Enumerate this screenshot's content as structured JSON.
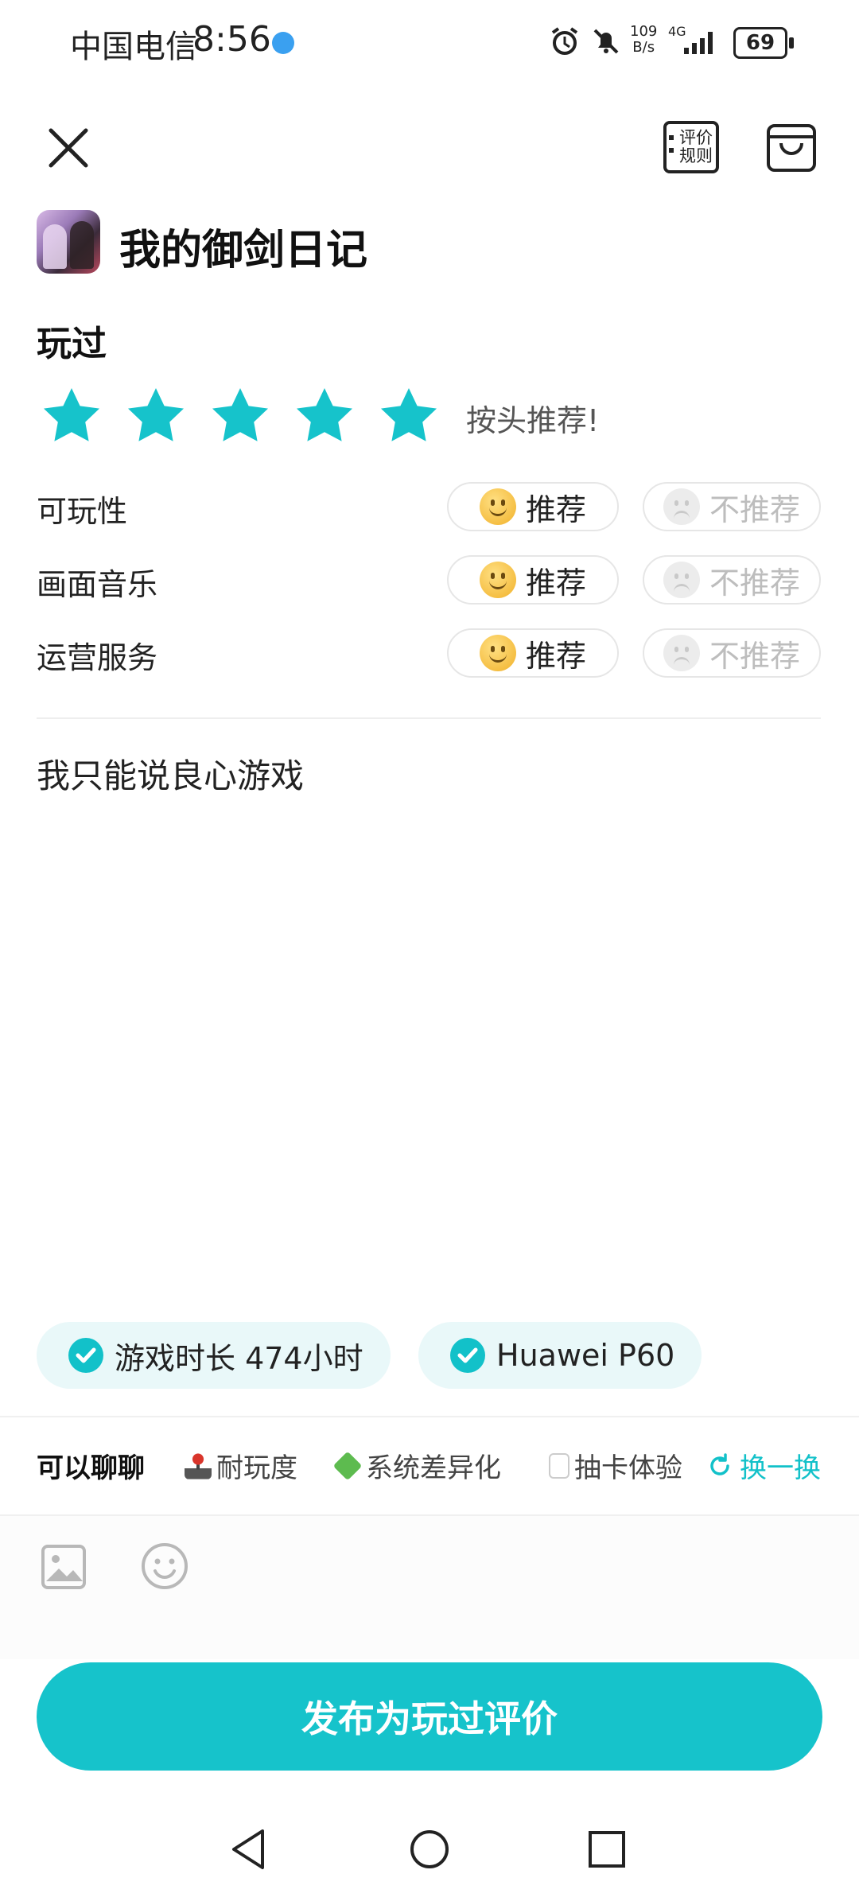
{
  "status_bar": {
    "carrier": "中国电信",
    "time": "8:56",
    "net_speed_value": "109",
    "net_speed_unit": "B/s",
    "network": "4G",
    "battery": "69"
  },
  "header": {
    "close_icon": "close-icon",
    "rules_label": "评价规则",
    "bag_icon": "bag-icon"
  },
  "game": {
    "title": "我的御剑日记"
  },
  "section": {
    "played_label": "玩过"
  },
  "rating": {
    "stars_filled": 5,
    "stars_total": 5,
    "star_color": "#16c3cb",
    "text": "按头推荐!"
  },
  "aspects": [
    {
      "label": "可玩性",
      "yes": "推荐",
      "no": "不推荐",
      "selected": "yes"
    },
    {
      "label": "画面音乐",
      "yes": "推荐",
      "no": "不推荐",
      "selected": "yes"
    },
    {
      "label": "运营服务",
      "yes": "推荐",
      "no": "不推荐",
      "selected": "yes"
    }
  ],
  "review": {
    "text": "我只能说良心游戏"
  },
  "tags": [
    {
      "label": "游戏时长 474小时",
      "checked": true
    },
    {
      "label": "Huawei P60",
      "checked": true
    }
  ],
  "topics": {
    "heading": "可以聊聊",
    "items": [
      "耐玩度",
      "系统差异化",
      "抽卡体验"
    ],
    "swap_label": "换一换"
  },
  "toolbar": {
    "image_icon": "image-icon",
    "emoji_icon": "emoji-icon"
  },
  "publish": {
    "label": "发布为玩过评价",
    "color": "#16c3cb"
  },
  "nav": {
    "back_icon": "back-icon",
    "home_icon": "home-icon",
    "recents_icon": "recents-icon"
  }
}
